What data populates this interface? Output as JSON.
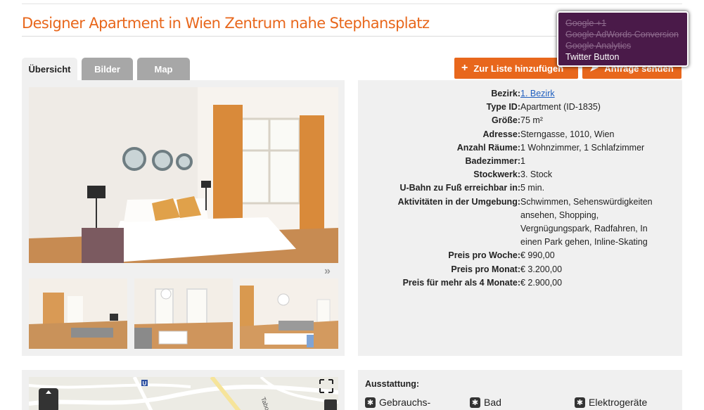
{
  "title": "Designer Apartment in Wien Zentrum nahe Stephansplatz",
  "tabs": [
    {
      "label": "Übersicht"
    },
    {
      "label": "Bilder"
    },
    {
      "label": "Map"
    }
  ],
  "actions": {
    "add_to_list": "Zur Liste hinzufügen",
    "request": "Anfrage senden"
  },
  "gallery": {
    "next_icon": "»"
  },
  "details": [
    {
      "label": "Bezirk:",
      "value": "1. Bezirk"
    },
    {
      "label": "Type ID:",
      "value": "Apartment (ID-1835)"
    },
    {
      "label": "Größe:",
      "value": "75 m²"
    },
    {
      "label": "Adresse:",
      "value": "Sterngasse, 1010, Wien"
    },
    {
      "label": "Anzahl Räume:",
      "value": "1 Wohnzimmer, 1 Schlafzimmer"
    },
    {
      "label": "Badezimmer:",
      "value": "1"
    },
    {
      "label": "Stockwerk:",
      "value": "3. Stock"
    },
    {
      "label": "U-Bahn zu Fuß erreichbar in:",
      "value": "5 min."
    },
    {
      "label": "Aktivitäten in der Umgebung:",
      "value": "Schwimmen, Sehenswürdigkeiten ansehen, Shopping, Vergnügungspark, Radfahren, In einen Park gehen, Inline-Skating"
    },
    {
      "label": "Preis pro Woche:",
      "value": "€ 990,00"
    },
    {
      "label": "Preis pro Monat:",
      "value": "€ 3.200,00"
    },
    {
      "label": "Preis für mehr als 4 Monate:",
      "value": "€ 2.900,00"
    }
  ],
  "amenities": {
    "title": "Ausstattung:",
    "items": [
      {
        "label": "Gebrauchs-"
      },
      {
        "label": "Bad"
      },
      {
        "label": "Elektrogeräte"
      }
    ]
  },
  "map": {
    "street_label": "Tabors",
    "metro_label": "U"
  },
  "consent": {
    "disabled": [
      "Google +1",
      "Google AdWords Conversion",
      "Google Analytics"
    ],
    "enabled": [
      "Twitter Button"
    ]
  },
  "colors": {
    "accent": "#e8671c",
    "consent_bg": "#4a1a49",
    "link": "#1f5fbf"
  },
  "icons": {
    "add": "plus-icon",
    "send": "send-arrow-icon",
    "amenity": "gear-icon",
    "fullscreen": "fullscreen-icon",
    "map_pan": "pan-control-icon"
  }
}
